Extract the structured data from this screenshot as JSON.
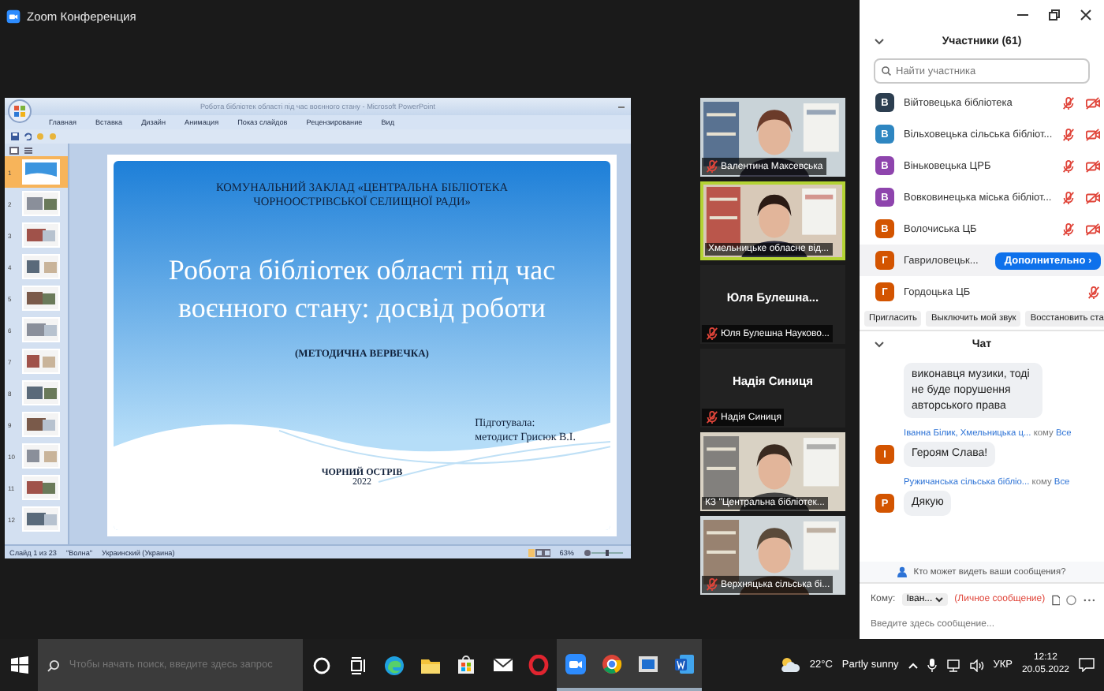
{
  "window": {
    "title": "Zoom Конференция"
  },
  "presentation": {
    "title": "Робота бібліотек області під час воєнного стану - Microsoft PowerPoint",
    "ribbon_tabs": [
      "Главная",
      "Вставка",
      "Дизайн",
      "Анимация",
      "Показ слайдов",
      "Рецензирование",
      "Вид"
    ],
    "slides": [
      {
        "number": "1",
        "selected": true
      },
      {
        "number": "2",
        "selected": false
      },
      {
        "number": "3",
        "selected": false
      },
      {
        "number": "4",
        "selected": false
      },
      {
        "number": "5",
        "selected": false
      },
      {
        "number": "6",
        "selected": false
      },
      {
        "number": "7",
        "selected": false
      },
      {
        "number": "8",
        "selected": false
      },
      {
        "number": "9",
        "selected": false
      },
      {
        "number": "10",
        "selected": false
      },
      {
        "number": "11",
        "selected": false
      },
      {
        "number": "12",
        "selected": false
      }
    ],
    "slide": {
      "header": "КОМУНАЛЬНИЙ ЗАКЛАД «ЦЕНТРАЛЬНА БІБЛІОТЕКА ЧОРНООСТРІВСЬКОЇ СЕЛИЩНОЇ РАДИ»",
      "title": "Робота бібліотек області під час воєнного стану: досвід роботи",
      "subtitle": "(МЕТОДИЧНА ВЕРВЕЧКА)",
      "author_label": "Підготувала:",
      "author": "методист Грисюк В.І.",
      "place": "ЧОРНИЙ ОСТРІВ",
      "year": "2022"
    },
    "status": [
      "Слайд 1 из 23",
      "\"Волна\"",
      "Украинский (Украина)"
    ],
    "zoom": "63%",
    "zoom_slider": {
      "level": 0.5
    }
  },
  "videos": [
    {
      "kind": "video",
      "name": "Валентина Максевська",
      "muted": true,
      "active": false
    },
    {
      "kind": "video",
      "name": "Хмельницьке обласне від...",
      "muted": false,
      "active": true
    },
    {
      "kind": "avatar",
      "display": "Юля Булешна...",
      "name": "Юля Булешна Науково...",
      "muted": true,
      "active": false
    },
    {
      "kind": "avatar",
      "display": "Надія Синиця",
      "name": "Надія Синиця",
      "muted": true,
      "active": false
    },
    {
      "kind": "video",
      "name": "КЗ \"Центральна бібліотек...",
      "muted": false,
      "active": false
    },
    {
      "kind": "video",
      "name": "Верхняцька сільська бі...",
      "muted": true,
      "active": false
    }
  ],
  "participants": {
    "title": "Участники (61)",
    "search": {
      "placeholder": "Найти участника"
    },
    "items": [
      {
        "initial": "В",
        "color": "#2c3e50",
        "name": "Війтовецька бібліотека",
        "mic_muted": true,
        "video_off": true,
        "highlighted": false
      },
      {
        "initial": "В",
        "color": "#2e86c1",
        "name": "Вільховецька сільська бібліот...",
        "mic_muted": true,
        "video_off": true,
        "highlighted": false
      },
      {
        "initial": "В",
        "color": "#8e44ad",
        "name": "Віньковецька ЦРБ",
        "mic_muted": true,
        "video_off": true,
        "highlighted": false
      },
      {
        "initial": "В",
        "color": "#8e44ad",
        "name": "Вовковинецька міська бібліот...",
        "mic_muted": true,
        "video_off": true,
        "highlighted": false
      },
      {
        "initial": "В",
        "color": "#d35400",
        "name": "Волочиська ЦБ",
        "mic_muted": true,
        "video_off": true,
        "highlighted": false
      },
      {
        "initial": "Г",
        "color": "#d35400",
        "name": "Гавриловецьк...",
        "highlighted": true,
        "action": "Дополнительно ›"
      },
      {
        "initial": "Г",
        "color": "#d35400",
        "name": "Гордоцька ЦБ",
        "mic_muted": true,
        "video_off": false,
        "highlighted": false
      }
    ],
    "buttons": [
      "Пригласить",
      "Выключить мой звук",
      "Восстановить ста"
    ]
  },
  "chat": {
    "title": "Чат",
    "messages": [
      {
        "text": "виконавця музики, тоді не буде порушення авторського права"
      },
      {
        "sender": "Іванна Білик, Хмельницька ц...",
        "to": "кому",
        "recipient": "Все",
        "initial": "І",
        "color": "#d35400",
        "text": "Героям Слава!"
      },
      {
        "sender": "Ружичанська сільська бібліо...",
        "to": "кому",
        "recipient": "Все",
        "initial": "Р",
        "color": "#d35400",
        "text": "Дякую"
      }
    ],
    "privacy_note": "Кто может видеть ваши сообщения?",
    "to_label": "Кому:",
    "recipient": "Іван...",
    "private_label": "(Личное сообщение)",
    "input": {
      "placeholder": "Введите здесь сообщение..."
    }
  },
  "taskbar": {
    "search": {
      "placeholder": "Чтобы начать поиск, введите здесь запрос"
    },
    "apps": [
      {
        "kind": "cortana",
        "active": false
      },
      {
        "kind": "taskview",
        "active": false
      },
      {
        "kind": "edge",
        "active": false
      },
      {
        "kind": "explorer",
        "active": false
      },
      {
        "kind": "store",
        "active": false
      },
      {
        "kind": "mail",
        "active": false
      },
      {
        "kind": "opera",
        "active": false
      },
      {
        "kind": "zoom",
        "active": true
      },
      {
        "kind": "chrome",
        "active": true
      },
      {
        "kind": "window",
        "active": true
      },
      {
        "kind": "word",
        "active": true
      }
    ],
    "temperature": "22°C",
    "weather": "Partly sunny",
    "language": "УКР",
    "time": "12:12",
    "date": "20.05.2022"
  }
}
